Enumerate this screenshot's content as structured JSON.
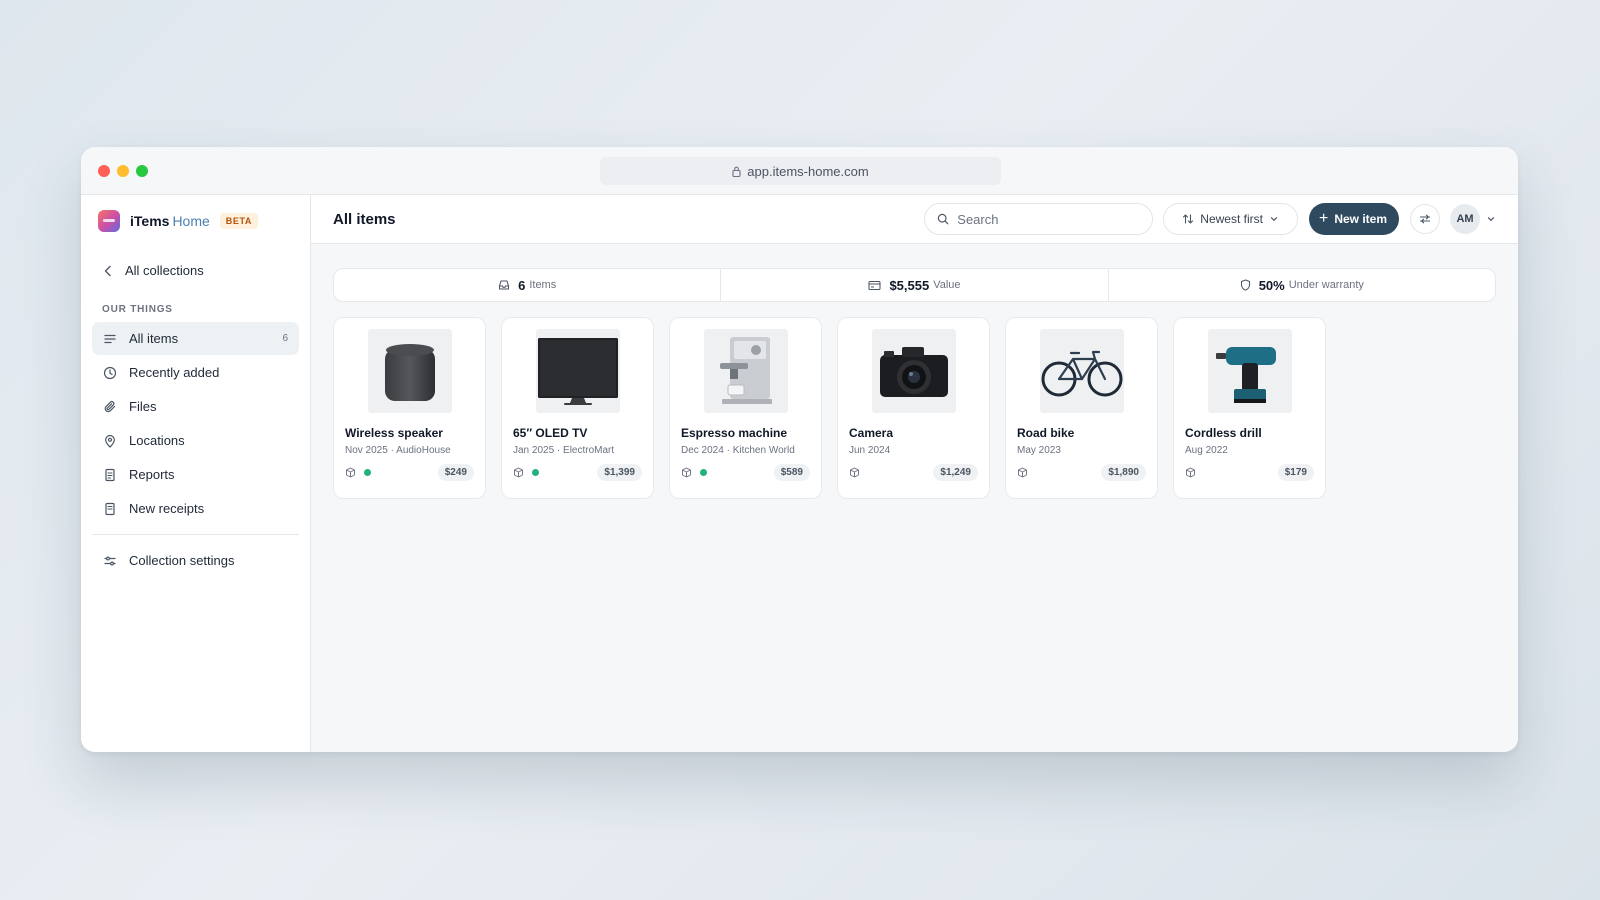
{
  "browser": {
    "url": "app.items-home.com"
  },
  "brand": {
    "name": "iTems",
    "name_suffix": "Home",
    "badge": "BETA"
  },
  "sidebar": {
    "back_label": "All collections",
    "section_label": "OUR THINGS",
    "items": [
      {
        "label": "All items",
        "count": "6",
        "icon": "list-icon",
        "active": true
      },
      {
        "label": "Recently added",
        "icon": "clock-icon"
      },
      {
        "label": "Files",
        "icon": "paperclip-icon"
      },
      {
        "label": "Locations",
        "icon": "map-pin-icon"
      },
      {
        "label": "Reports",
        "icon": "report-icon"
      },
      {
        "label": "New receipts",
        "icon": "receipt-icon"
      }
    ],
    "settings_label": "Collection settings"
  },
  "header": {
    "title": "All items",
    "search_placeholder": "Search",
    "sort_label": "Newest first",
    "new_button": "New item",
    "avatar_initials": "AM"
  },
  "stats": [
    {
      "value": "6",
      "label": "Items",
      "icon": "inbox-icon"
    },
    {
      "value": "$5,555",
      "label": "Value",
      "icon": "card-icon"
    },
    {
      "value": "50%",
      "label": "Under warranty",
      "icon": "shield-icon"
    }
  ],
  "items": [
    {
      "title": "Wireless speaker",
      "meta": "Nov 2025 · AudioHouse",
      "price": "$249",
      "warranty_active": true,
      "image": "speaker"
    },
    {
      "title": "65″ OLED TV",
      "meta": "Jan 2025 · ElectroMart",
      "price": "$1,399",
      "warranty_active": true,
      "image": "tv"
    },
    {
      "title": "Espresso machine",
      "meta": "Dec 2024 · Kitchen World",
      "price": "$589",
      "warranty_active": true,
      "image": "espresso"
    },
    {
      "title": "Camera",
      "meta": "Jun 2024",
      "price": "$1,249",
      "warranty_active": false,
      "image": "camera"
    },
    {
      "title": "Road bike",
      "meta": "May 2023",
      "price": "$1,890",
      "warranty_active": false,
      "image": "bike"
    },
    {
      "title": "Cordless drill",
      "meta": "Aug 2022",
      "price": "$179",
      "warranty_active": false,
      "image": "drill"
    }
  ],
  "colors": {
    "primary": "#2f4a5f",
    "status_green": "#22b07d",
    "beta_text": "#b45309"
  }
}
